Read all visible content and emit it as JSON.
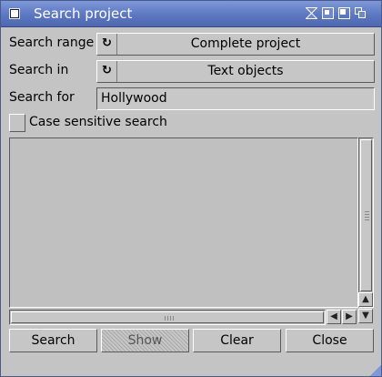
{
  "window": {
    "title": "Search project"
  },
  "form": {
    "range_label": "Search range",
    "range_value": "Complete project",
    "in_label": "Search in",
    "in_value": "Text objects",
    "for_label": "Search for",
    "for_value": "Hollywood",
    "case_label": "Case sensitive search",
    "case_checked": false
  },
  "buttons": {
    "search": "Search",
    "show": "Show",
    "clear": "Clear",
    "close": "Close"
  },
  "icons": {
    "cycle": "↻",
    "scroll_up": "▲",
    "scroll_down": "▼",
    "scroll_left": "◀",
    "scroll_right": "▶"
  },
  "colors": {
    "titlebar": "#5c78c2",
    "window_bg": "#c4c4c4"
  }
}
